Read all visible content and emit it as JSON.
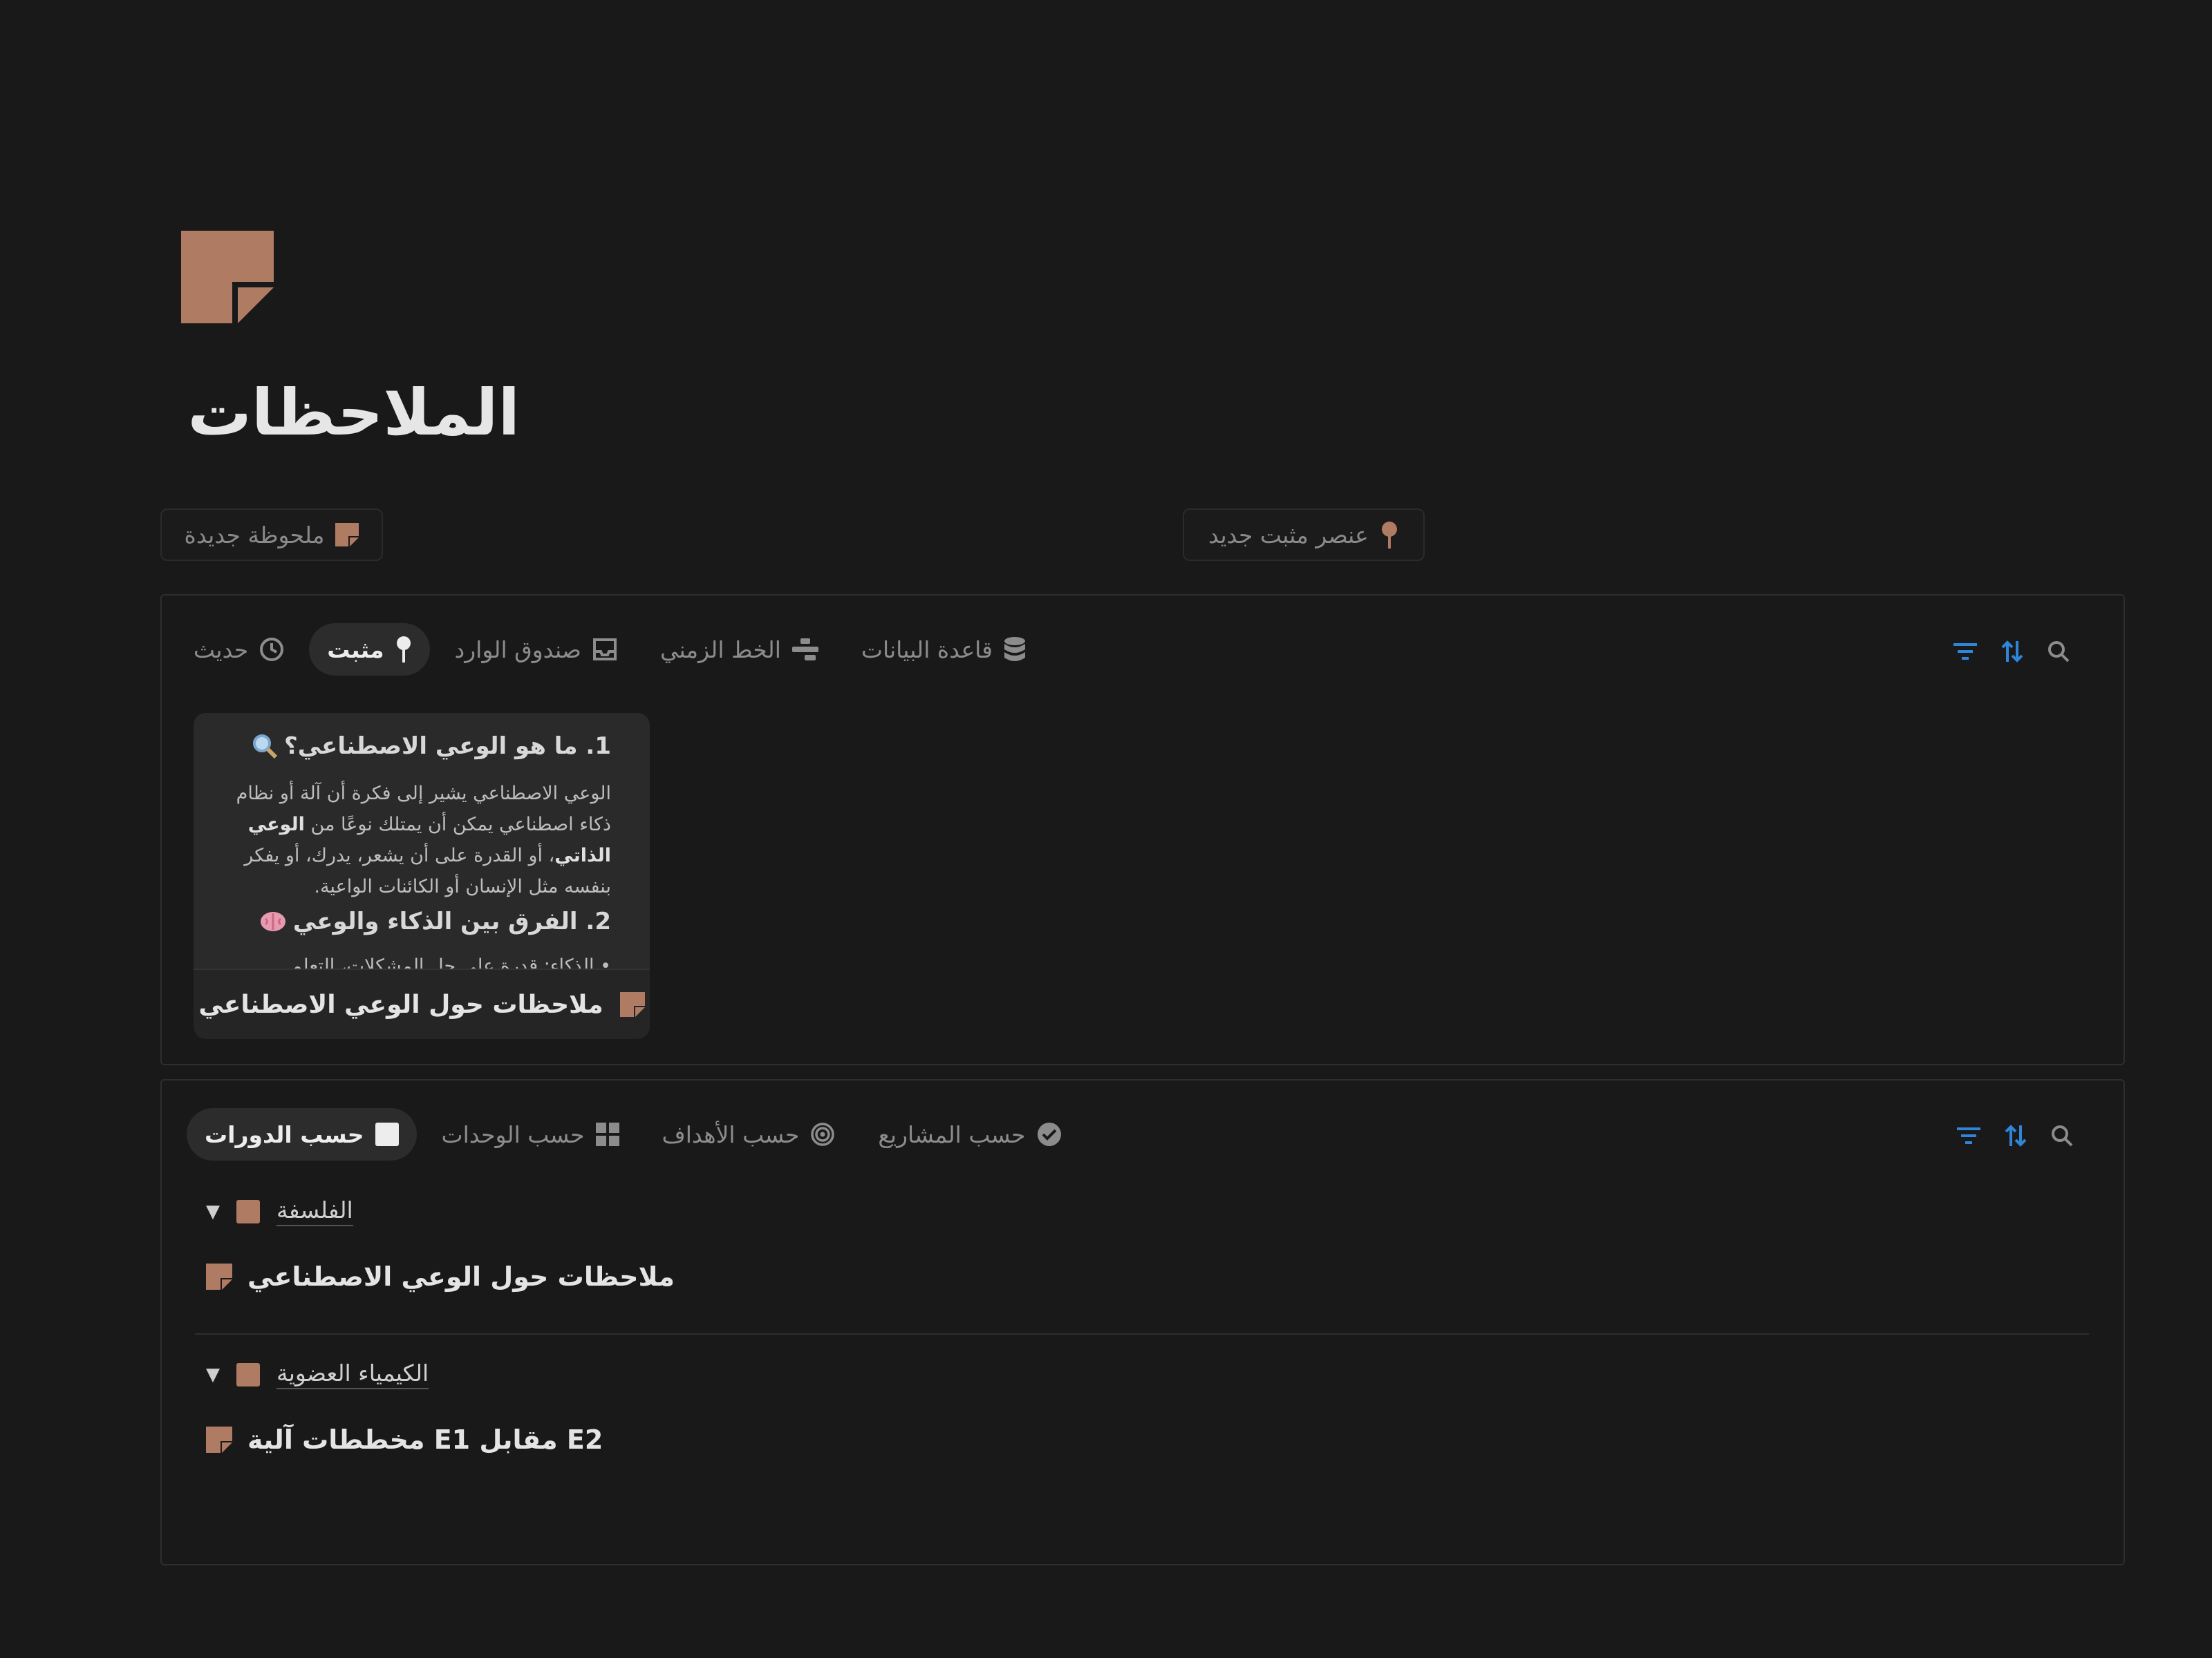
{
  "page": {
    "title": "الملاحظات",
    "icon": "note-icon",
    "accent_color": "#b07b63"
  },
  "actions": {
    "new_note": "ملحوظة جديدة",
    "new_pinned": "عنصر مثبت جديد"
  },
  "views_top": {
    "tabs": [
      {
        "label": "حديث",
        "icon": "clock-icon",
        "active": false
      },
      {
        "label": "مثبت",
        "icon": "pin-icon",
        "active": true
      },
      {
        "label": "صندوق الوارد",
        "icon": "inbox-icon",
        "active": false
      },
      {
        "label": "الخط الزمني",
        "icon": "timeline-icon",
        "active": false
      },
      {
        "label": "قاعدة البيانات",
        "icon": "database-icon",
        "active": false
      }
    ],
    "tools": [
      "filter-icon",
      "sort-icon",
      "search-icon"
    ],
    "card": {
      "heading1": "1. ما هو الوعي الاصطناعي؟",
      "paragraph1_a": "الوعي الاصطناعي يشير إلى فكرة أن آلة أو نظام ذكاء اصطناعي يمكن أن يمتلك نوعًا من ",
      "paragraph1_bold": "الوعي الذاتي",
      "paragraph1_b": "، أو القدرة على أن يشعر، يدرك، أو يفكر بنفسه مثل الإنسان أو الكائنات الواعية.",
      "heading2": "2. الفرق بين الذكاء والوعي",
      "bullet_partial": "الذكاء: قدرة على حل المشكلات، التعلم",
      "title": "ملاحظات حول الوعي الاصطناعي"
    }
  },
  "views_bottom": {
    "tabs": [
      {
        "label": "حسب الدورات",
        "icon": "square-icon",
        "active": true
      },
      {
        "label": "حسب الوحدات",
        "icon": "grid-icon",
        "active": false
      },
      {
        "label": "حسب الأهداف",
        "icon": "target-icon",
        "active": false
      },
      {
        "label": "حسب المشاريع",
        "icon": "check-circle-icon",
        "active": false
      }
    ],
    "tools": [
      "filter-icon",
      "sort-icon",
      "search-icon"
    ],
    "groups": [
      {
        "label": "الفلسفة",
        "items": [
          "ملاحظات حول الوعي الاصطناعي"
        ]
      },
      {
        "label": "الكيمياء العضوية",
        "items": [
          "E2 مقابل E1 مخططات آلية"
        ]
      }
    ]
  }
}
